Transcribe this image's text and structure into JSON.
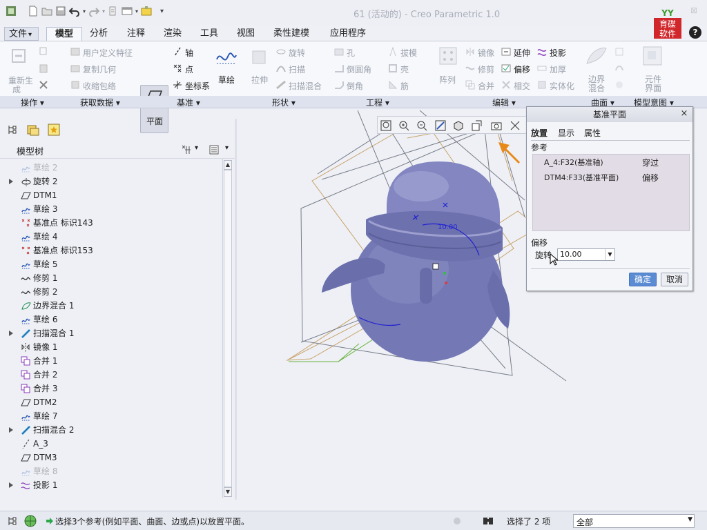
{
  "window": {
    "title": "61 (活动的) - Creo Parametric 1.0",
    "close": "⊠",
    "help": "?",
    "logo_text_top": "育碟",
    "logo_text_bottom": "软件",
    "logo_mark": "YY"
  },
  "menu": {
    "tabs": [
      "文件",
      "模型",
      "分析",
      "注释",
      "渲染",
      "工具",
      "视图",
      "柔性建模",
      "应用程序"
    ],
    "file_arrow": "▾"
  },
  "ribbon": {
    "operations": {
      "regen_line1": "重新生",
      "regen_line2": "成"
    },
    "get_data": {
      "udf": "用户定义特征",
      "copy_geom": "复制几何",
      "shrinkwrap": "收缩包络"
    },
    "datum": {
      "plane": "平面",
      "axis": "轴",
      "point": "点",
      "csys": "坐标系",
      "sketch": "草绘"
    },
    "shapes": {
      "extrude": "拉伸",
      "revolve": "旋转",
      "sweep": "扫描",
      "swept_blend": "扫描混合"
    },
    "engineering": {
      "hole": "孔",
      "round": "倒圆角",
      "chamfer": "倒角",
      "draft": "拔模",
      "shell": "壳",
      "rib": "筋"
    },
    "editing": {
      "pattern": "阵列",
      "mirror": "镜像",
      "trim": "修剪",
      "merge": "合并",
      "extend": "延伸",
      "offset": "偏移",
      "intersect": "相交",
      "project": "投影",
      "thicken": "加厚",
      "solidify": "实体化"
    },
    "surfaces": {
      "boundary_line1": "边界",
      "boundary_line2": "混合"
    },
    "model_intent": {
      "component_line1": "元件",
      "component_line2": "界面"
    }
  },
  "groups": [
    "操作",
    "获取数据",
    "基准",
    "形状",
    "工程",
    "编辑",
    "曲面",
    "模型意图"
  ],
  "model_tree": {
    "title": "模型树",
    "items": [
      {
        "label": "草绘 2",
        "icon": "sketch-icon",
        "expand": false,
        "dim": true
      },
      {
        "label": "旋转 2",
        "icon": "revolve-icon",
        "expand": true,
        "dim": false
      },
      {
        "label": "DTM1",
        "icon": "datum-plane-icon",
        "expand": false,
        "dim": false
      },
      {
        "label": "草绘 3",
        "icon": "sketch-icon",
        "expand": false,
        "dim": false
      },
      {
        "label": "基准点 标识143",
        "icon": "datum-point-icon",
        "expand": false,
        "dim": false
      },
      {
        "label": "草绘 4",
        "icon": "sketch-icon",
        "expand": false,
        "dim": false
      },
      {
        "label": "基准点 标识153",
        "icon": "datum-point-icon",
        "expand": false,
        "dim": false
      },
      {
        "label": "草绘 5",
        "icon": "sketch-icon",
        "expand": false,
        "dim": false
      },
      {
        "label": "修剪 1",
        "icon": "trim-icon",
        "expand": false,
        "dim": false
      },
      {
        "label": "修剪 2",
        "icon": "trim-icon",
        "expand": false,
        "dim": false
      },
      {
        "label": "边界混合 1",
        "icon": "boundary-blend-icon",
        "expand": false,
        "dim": false
      },
      {
        "label": "草绘 6",
        "icon": "sketch-icon",
        "expand": false,
        "dim": false
      },
      {
        "label": "扫描混合 1",
        "icon": "swept-blend-icon",
        "expand": true,
        "dim": false
      },
      {
        "label": "镜像 1",
        "icon": "mirror-icon",
        "expand": false,
        "dim": false
      },
      {
        "label": "合并 1",
        "icon": "merge-icon",
        "expand": false,
        "dim": false
      },
      {
        "label": "合并 2",
        "icon": "merge-icon",
        "expand": false,
        "dim": false
      },
      {
        "label": "合并 3",
        "icon": "merge-icon",
        "expand": false,
        "dim": false
      },
      {
        "label": "DTM2",
        "icon": "datum-plane-icon",
        "expand": false,
        "dim": false
      },
      {
        "label": "草绘 7",
        "icon": "sketch-icon",
        "expand": false,
        "dim": false
      },
      {
        "label": "扫描混合 2",
        "icon": "swept-blend-icon",
        "expand": true,
        "dim": false
      },
      {
        "label": "A_3",
        "icon": "axis-icon",
        "expand": false,
        "dim": false
      },
      {
        "label": "DTM3",
        "icon": "datum-plane-icon",
        "expand": false,
        "dim": false
      },
      {
        "label": "草绘 8",
        "icon": "sketch-icon",
        "expand": false,
        "dim": true
      },
      {
        "label": "投影 1",
        "icon": "project-icon",
        "expand": true,
        "dim": false
      }
    ]
  },
  "viewport": {
    "dimension_label": "10.00"
  },
  "dialog": {
    "title": "基准平面",
    "close": "×",
    "tabs": [
      "放置",
      "显示",
      "属性"
    ],
    "references_label": "参考",
    "references": [
      {
        "ref": "A_4:F32(基准轴)",
        "constraint": "穿过"
      },
      {
        "ref": "DTM4:F33(基准平面)",
        "constraint": "偏移"
      }
    ],
    "offset_label": "偏移",
    "rotation_label": "旋转",
    "rotation_value": "10.00",
    "ok": "确定",
    "cancel": "取消"
  },
  "status": {
    "message": "选择3个参考(例如平面、曲面、边或点)以放置平面。",
    "selected": "选择了 2 项",
    "filter": "全部"
  },
  "colors": {
    "model_body": "#7b7fb9",
    "accent_blue": "#5b8bd3",
    "datum_orange": "#c9a36a"
  }
}
